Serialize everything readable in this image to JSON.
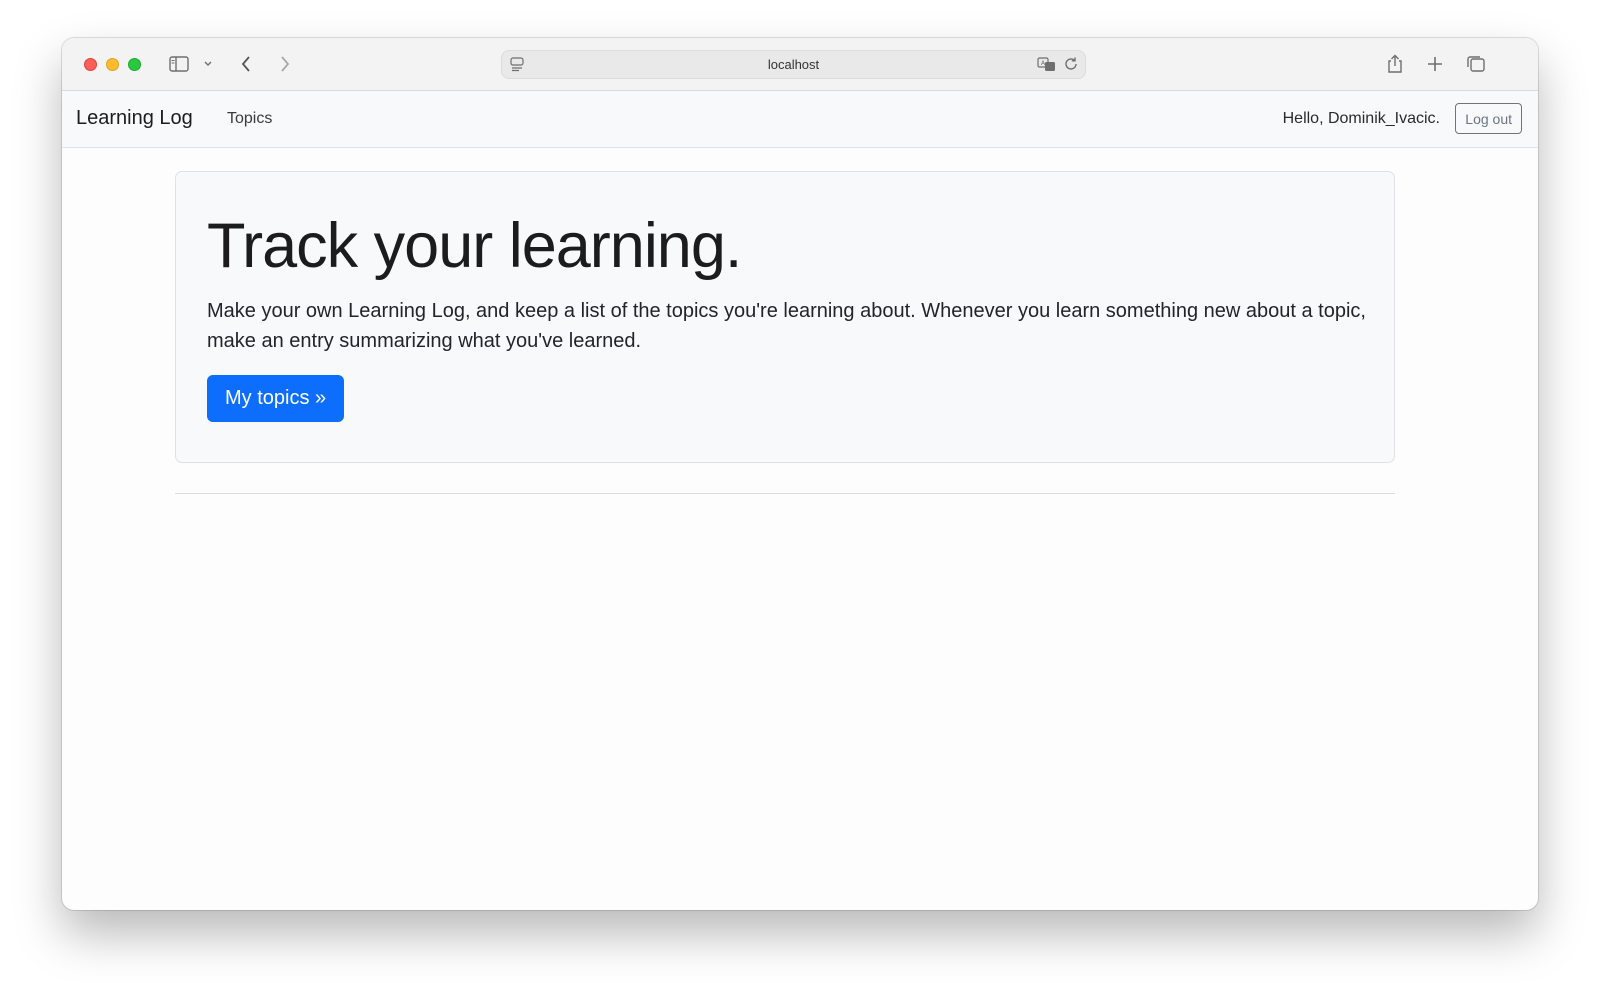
{
  "browser": {
    "url": "localhost"
  },
  "navbar": {
    "brand": "Learning Log",
    "links": [
      {
        "label": "Topics"
      }
    ],
    "greeting": "Hello, Dominik_Ivacic.",
    "logout_label": "Log out"
  },
  "hero": {
    "title": "Track your learning.",
    "description": "Make your own Learning Log, and keep a list of the topics you're learning about. Whenever you learn something new about a topic, make an entry summarizing what you've learned.",
    "button_label": "My topics »"
  },
  "colors": {
    "primary": "#0d6efd",
    "navbar_bg": "#f8f9fa"
  }
}
